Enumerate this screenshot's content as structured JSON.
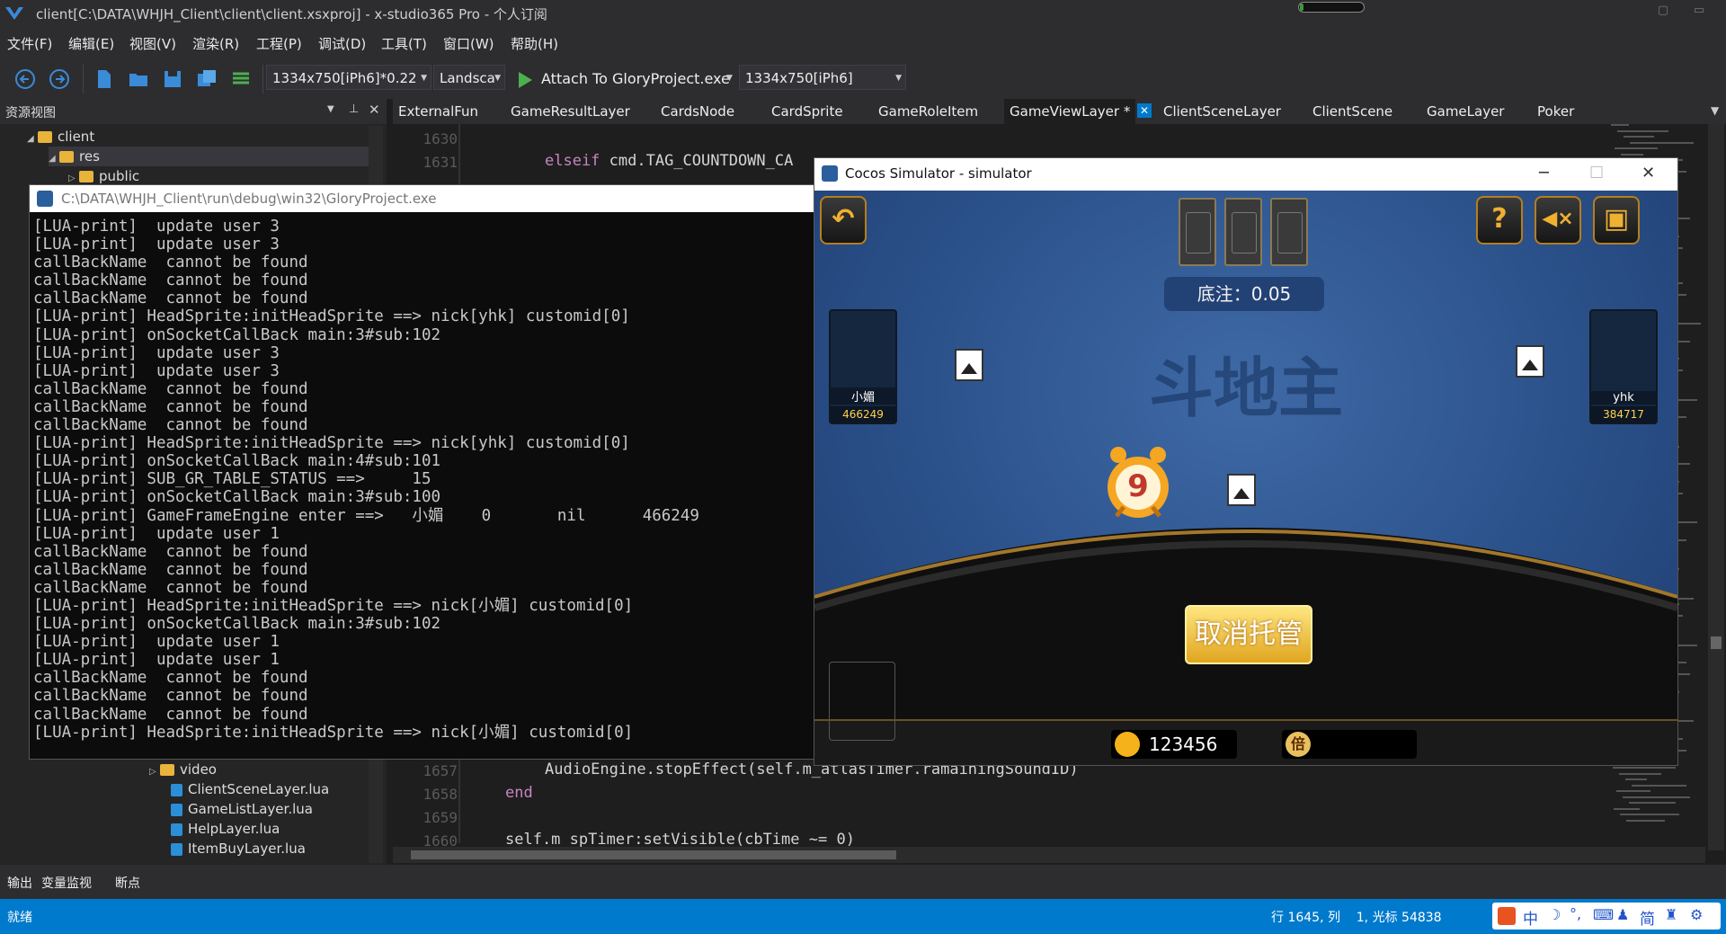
{
  "window": {
    "title": "client[C:\\DATA\\WHJH_Client\\client\\client.xsxproj] - x-studio365 Pro - 个人订阅",
    "minimize": "▢",
    "maximize": "▭",
    "progress": 0.05
  },
  "menu": [
    "文件(F)",
    "编辑(E)",
    "视图(V)",
    "渲染(R)",
    "工程(P)",
    "调试(D)",
    "工具(T)",
    "窗口(W)",
    "帮助(H)"
  ],
  "toolbar": {
    "resolution": "1334x750[iPh6]*0.22",
    "orientation": "Landsca",
    "attach": "Attach To GloryProject.exe",
    "resolution2": "1334x750[iPh6]"
  },
  "explorer": {
    "title": "资源视图",
    "items": [
      {
        "label": "client",
        "type": "folder"
      },
      {
        "label": "res",
        "type": "folder"
      },
      {
        "label": "public",
        "type": "folder"
      },
      {
        "label": "video",
        "type": "folder"
      },
      {
        "label": "ClientSceneLayer.lua",
        "type": "lua"
      },
      {
        "label": "GameListLayer.lua",
        "type": "lua"
      },
      {
        "label": "HelpLayer.lua",
        "type": "lua"
      },
      {
        "label": "ItemBuyLayer.lua",
        "type": "lua"
      }
    ]
  },
  "tabs": [
    "ExternalFun",
    "GameResultLayer",
    "CardsNode",
    "CardSprite",
    "GameRoleItem",
    "GameViewLayer *",
    "ClientSceneLayer",
    "ClientScene",
    "GameLayer",
    "Poker"
  ],
  "code": {
    "top_lines": [
      {
        "num": "1630",
        "text": ""
      },
      {
        "num": "1631",
        "kw": "elseif",
        "rest": " cmd.TAG_COUNTDOWN_CA"
      }
    ],
    "bottom_lines": [
      {
        "num": "1657",
        "text": "AudioEngine.stopEffect(self.m_atlasTimer.ramainingSoundID)"
      },
      {
        "num": "1658",
        "text": "end"
      },
      {
        "num": "1659",
        "text": ""
      },
      {
        "num": "1660",
        "text": "self.m_spTimer:setVisible(cbTime ~= 0)"
      }
    ]
  },
  "console": {
    "title": "C:\\DATA\\WHJH_Client\\run\\debug\\win32\\GloryProject.exe",
    "lines": [
      "[LUA-print]  update user 3",
      "[LUA-print]  update user 3",
      "callBackName  cannot be found",
      "callBackName  cannot be found",
      "callBackName  cannot be found",
      "[LUA-print] HeadSprite:initHeadSprite ==> nick[yhk] customid[0]",
      "[LUA-print] onSocketCallBack main:3#sub:102",
      "[LUA-print]  update user 3",
      "[LUA-print]  update user 3",
      "callBackName  cannot be found",
      "callBackName  cannot be found",
      "callBackName  cannot be found",
      "[LUA-print] HeadSprite:initHeadSprite ==> nick[yhk] customid[0]",
      "[LUA-print] onSocketCallBack main:4#sub:101",
      "[LUA-print] SUB_GR_TABLE_STATUS ==>     15",
      "[LUA-print] onSocketCallBack main:3#sub:100",
      "[LUA-print] GameFrameEngine enter ==>   小媚    0       nil      466249",
      "[LUA-print]  update user 1",
      "callBackName  cannot be found",
      "callBackName  cannot be found",
      "callBackName  cannot be found",
      "[LUA-print] HeadSprite:initHeadSprite ==> nick[小媚] customid[0]",
      "[LUA-print] onSocketCallBack main:3#sub:102",
      "[LUA-print]  update user 1",
      "[LUA-print]  update user 1",
      "callBackName  cannot be found",
      "callBackName  cannot be found",
      "callBackName  cannot be found",
      "[LUA-print] HeadSprite:initHeadSprite ==> nick[小媚] customid[0]"
    ]
  },
  "simulator": {
    "title": "Cocos Simulator - simulator",
    "base_bet": "底注：0.05",
    "logo": "斗地主",
    "timer": "9",
    "left_player": {
      "name": "小媚",
      "gold": "466249"
    },
    "right_player": {
      "name": "yhk",
      "gold": "384717"
    },
    "cancel_auto": "取消托管",
    "my_gold": "123456",
    "multiplier_icon": "倍",
    "buttons": {
      "back": "↶",
      "help": "?",
      "mute": "◀×",
      "robot": "▣"
    }
  },
  "output": {
    "tabs": [
      "输出",
      "变量监视",
      "断点"
    ]
  },
  "status": {
    "ready": "就绪",
    "position": "行 1645, 列    1, 光标 54838",
    "ime": [
      "中",
      "简"
    ]
  },
  "colors": {
    "accent": "#007acc",
    "gold": "#f0b030"
  }
}
